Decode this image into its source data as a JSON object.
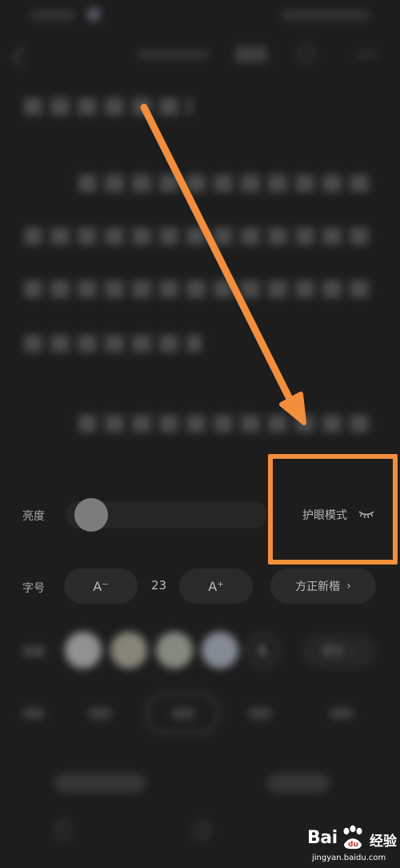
{
  "settings": {
    "brightness_label": "亮度",
    "eye_mode_label": "护眼模式",
    "font_size_label": "字号",
    "font_decrease": "A⁻",
    "font_size_value": "23",
    "font_increase": "A⁺",
    "font_name": "方正新楷",
    "background_label": "背景",
    "more_label": "更多",
    "brightness_level_percent": 5,
    "background_colors": [
      "#b8b8b8",
      "#aaa898",
      "#a6b0a0",
      "#a8b0bc"
    ]
  },
  "watermark": {
    "brand": "Bai",
    "brand_du": "du",
    "experience": "经验",
    "url": "jingyan.baidu.com"
  },
  "annotation": {
    "highlight_color": "#f28e3c"
  }
}
